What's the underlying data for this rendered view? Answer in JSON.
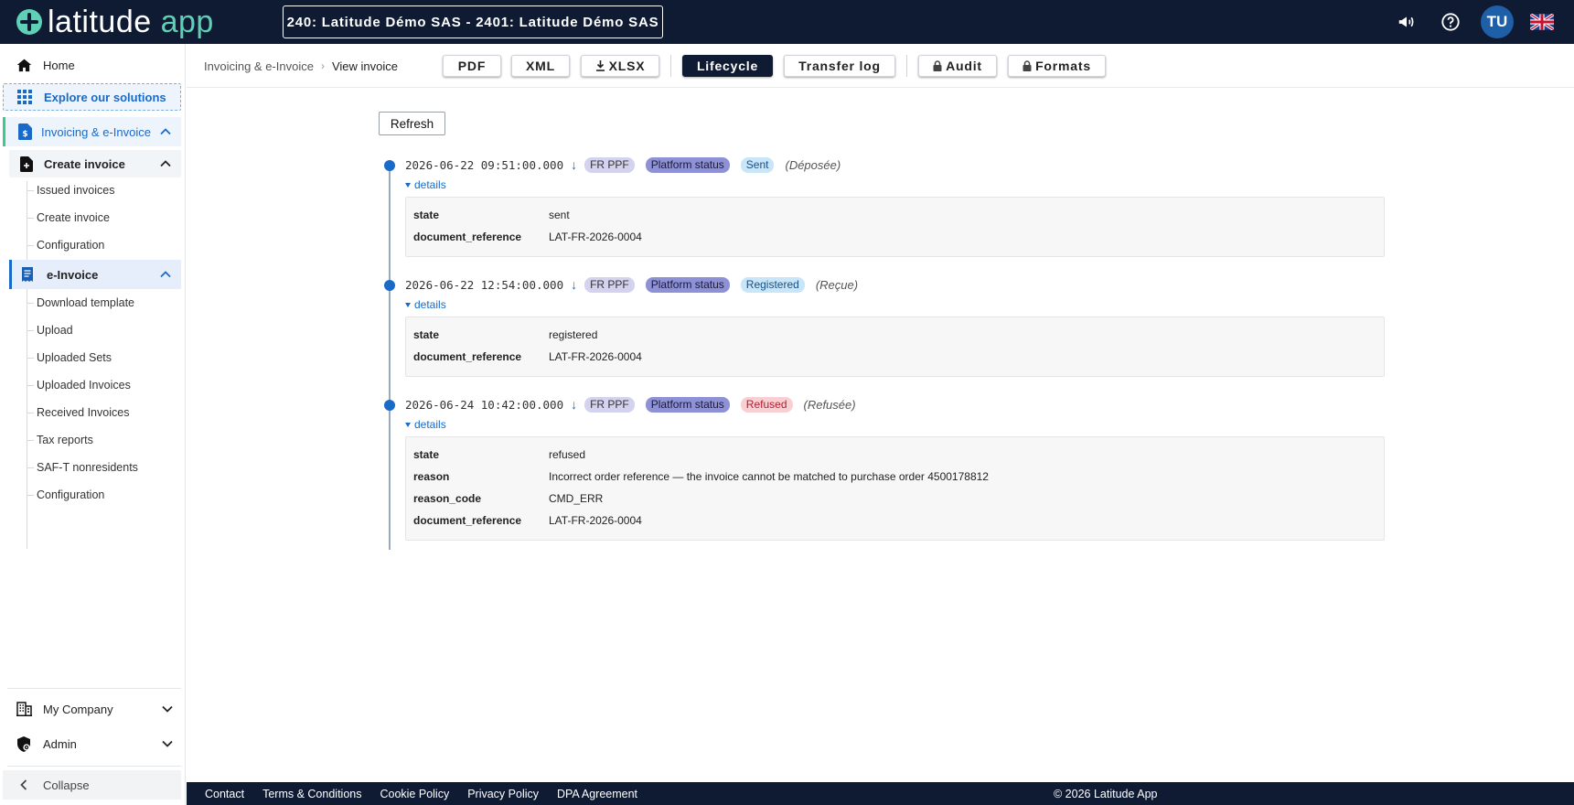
{
  "header": {
    "logo_main": "latitude",
    "logo_accent": "app",
    "tenant": "240: Latitude Démo SAS - 2401: Latitude Démo SAS",
    "user_initials": "TU"
  },
  "sidebar": {
    "home": "Home",
    "explore": "Explore our solutions",
    "invoicing": "Invoicing & e-Invoice",
    "create_invoice": {
      "label": "Create invoice",
      "items": [
        "Issued invoices",
        "Create invoice",
        "Configuration"
      ]
    },
    "einvoice": {
      "label": "e-Invoice",
      "items": [
        "Download template",
        "Upload",
        "Uploaded Sets",
        "Uploaded Invoices",
        "Received Invoices",
        "Tax reports",
        "SAF-T nonresidents",
        "Configuration"
      ]
    },
    "my_company": "My Company",
    "admin": "Admin",
    "collapse": "Collapse"
  },
  "breadcrumb": {
    "parent": "Invoicing & e-Invoice",
    "current": "View invoice"
  },
  "toolbar": {
    "pdf": "PDF",
    "xml": "XML",
    "xlsx": "XLSX",
    "lifecycle": "Lifecycle",
    "transfer_log": "Transfer log",
    "audit": "Audit",
    "formats": "Formats"
  },
  "refresh_label": "Refresh",
  "events": [
    {
      "timestamp": "2026-06-22 09:51:00.000",
      "arrow": "↓",
      "source": "FR PPF",
      "type": "Platform status",
      "status": "Sent",
      "status_color": "#c8e6f8",
      "original": "(Déposée)",
      "details_label": "details",
      "fields": [
        {
          "key": "state",
          "value": "sent"
        },
        {
          "key": "document_reference",
          "value": "LAT-FR-2026-0004"
        }
      ]
    },
    {
      "timestamp": "2026-06-22 12:54:00.000",
      "arrow": "↓",
      "source": "FR PPF",
      "type": "Platform status",
      "status": "Registered",
      "status_color": "#c8e6f8",
      "original": "(Reçue)",
      "details_label": "details",
      "fields": [
        {
          "key": "state",
          "value": "registered"
        },
        {
          "key": "document_reference",
          "value": "LAT-FR-2026-0004"
        }
      ]
    },
    {
      "timestamp": "2026-06-24 10:42:00.000",
      "arrow": "↓",
      "source": "FR PPF",
      "type": "Platform status",
      "status": "Refused",
      "status_color": "#f8d0d4",
      "original": "(Refusée)",
      "details_label": "details",
      "fields": [
        {
          "key": "state",
          "value": "refused"
        },
        {
          "key": "reason",
          "value": "Incorrect order reference — the invoice cannot be matched to purchase order 4500178812"
        },
        {
          "key": "reason_code",
          "value": "CMD_ERR"
        },
        {
          "key": "document_reference",
          "value": "LAT-FR-2026-0004"
        }
      ]
    }
  ],
  "footer": {
    "links": [
      "Contact",
      "Terms & Conditions",
      "Cookie Policy",
      "Privacy Policy",
      "DPA Agreement"
    ],
    "copyright": "© 2026 Latitude App"
  }
}
